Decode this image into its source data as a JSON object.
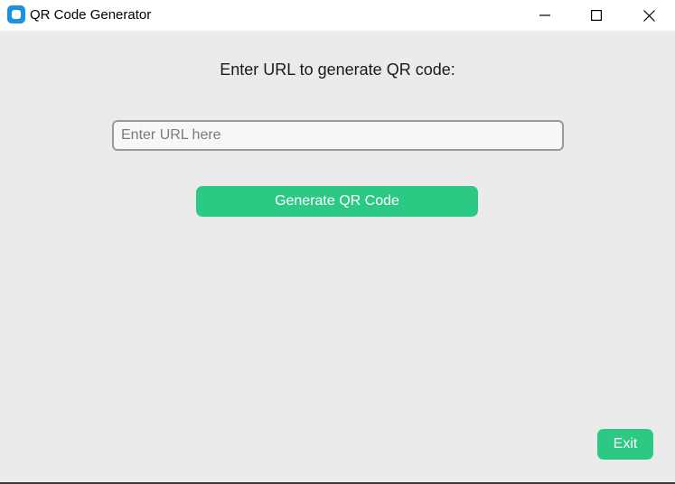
{
  "window": {
    "title": "QR Code Generator",
    "icon": "app-icon",
    "controls": [
      "minimize-icon",
      "maximize-icon",
      "close-icon"
    ]
  },
  "main": {
    "prompt": "Enter URL to generate QR code:",
    "url_input": {
      "value": "",
      "placeholder": "Enter URL here"
    },
    "generate_label": "Generate QR Code",
    "exit_label": "Exit"
  },
  "colors": {
    "accent": "#2cc985",
    "background": "#ebebeb",
    "titlebar": "#ffffff"
  }
}
